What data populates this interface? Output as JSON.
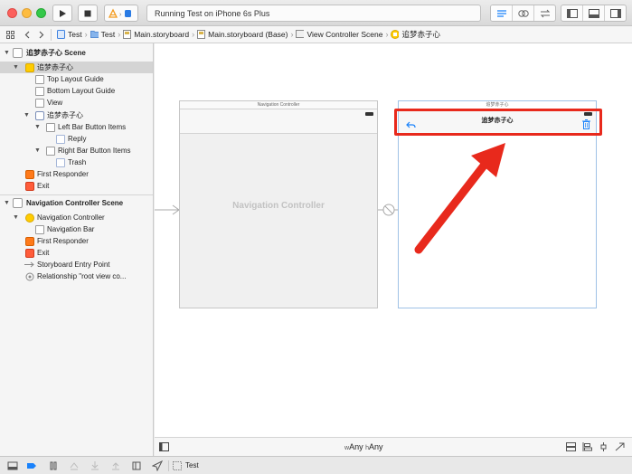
{
  "toolbar": {
    "activity_text": "Running Test on iPhone 6s Plus"
  },
  "jumpbar": {
    "crumbs": [
      "Test",
      "Test",
      "Main.storyboard",
      "Main.storyboard (Base)",
      "View Controller Scene",
      "追梦赤子心"
    ]
  },
  "outline": {
    "scene1_title": "追梦赤子心 Scene",
    "vc_name": "追梦赤子心",
    "top_layout_guide": "Top Layout Guide",
    "bottom_layout_guide": "Bottom Layout Guide",
    "view": "View",
    "nav_item": "追梦赤子心",
    "left_bar_button_items": "Left Bar Button Items",
    "reply": "Reply",
    "right_bar_button_items": "Right Bar Button Items",
    "trash": "Trash",
    "first_responder_1": "First Responder",
    "exit_1": "Exit",
    "scene2_title": "Navigation Controller Scene",
    "navigation_controller": "Navigation Controller",
    "navigation_bar": "Navigation Bar",
    "first_responder_2": "First Responder",
    "exit_2": "Exit",
    "storyboard_entry_point": "Storyboard Entry Point",
    "relationship": "Relationship \"root view co..."
  },
  "canvas": {
    "navc_title": "Navigation Controller",
    "navc_placeholder": "Navigation Controller",
    "vc_title": "追梦赤子心",
    "vc_navbar_title": "追梦赤子心"
  },
  "bottom": {
    "w_prefix": "w",
    "w_value": "Any",
    "h_prefix": "h",
    "h_value": "Any"
  },
  "debug": {
    "target": "Test"
  },
  "colors": {
    "highlight": "#e8291c",
    "arrow": "#e8291c",
    "selection": "#1a82fb"
  }
}
